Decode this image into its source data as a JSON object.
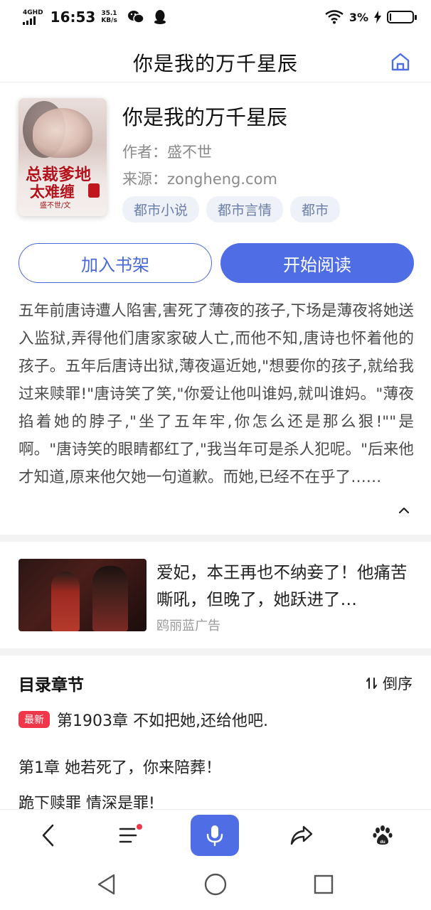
{
  "status_bar": {
    "network": "4GHD",
    "time": "16:53",
    "speed_value": "35.1",
    "speed_unit": "KB/s",
    "battery": "3%",
    "battery_level": 0.03
  },
  "header": {
    "title": "你是我的万千星辰"
  },
  "book": {
    "title": "你是我的万千星辰",
    "author": "作者：盛不世",
    "source": "来源：zongheng.com",
    "tags": [
      "都市小说",
      "都市言情",
      "都市"
    ],
    "cover_line1": "总裁爹地",
    "cover_line2": "太难缠",
    "cover_author": "盛不世/文"
  },
  "actions": {
    "add_shelf": "加入书架",
    "start_reading": "开始阅读"
  },
  "synopsis": "五年前唐诗遭人陷害,害死了薄夜的孩子,下场是薄夜将她送入监狱,弄得他们唐家家破人亡,而他不知,唐诗也怀着他的孩子。五年后唐诗出狱,薄夜逼近她,\"想要你的孩子,就给我过来赎罪!\"唐诗笑了笑,\"你爱让他叫谁妈,就叫谁妈。\"薄夜掐着她的脖子,\"坐了五年牢,你怎么还是那么狠!\"\"是啊。\"唐诗笑的眼睛都红了,\"我当年可是杀人犯呢。\"后来他才知道,原来他欠她一句道歉。而她,已经不在乎了……",
  "ad": {
    "title": "爱妃，本王再也不纳妾了！他痛苦嘶吼，但晚了，她跃进了…",
    "source": "鸥丽蓝广告"
  },
  "catalog": {
    "title": "目录章节",
    "sort_label": "倒序",
    "latest_badge": "最新",
    "latest_chapter": "第1903章 不如把她,还给他吧.",
    "chapter_1": "第1章 她若死了，你来陪葬！",
    "chapter_2": "跪下赎罪 情深是罪!"
  },
  "bottom_nav": {
    "items": [
      "back-icon",
      "menu-icon",
      "microphone-icon",
      "share-icon",
      "baidu-paw-icon"
    ]
  },
  "colors": {
    "accent": "#4f6ee6",
    "badge": "#f0364a",
    "tag_bg": "#eef1f8",
    "tag_text": "#6b7fa8"
  }
}
